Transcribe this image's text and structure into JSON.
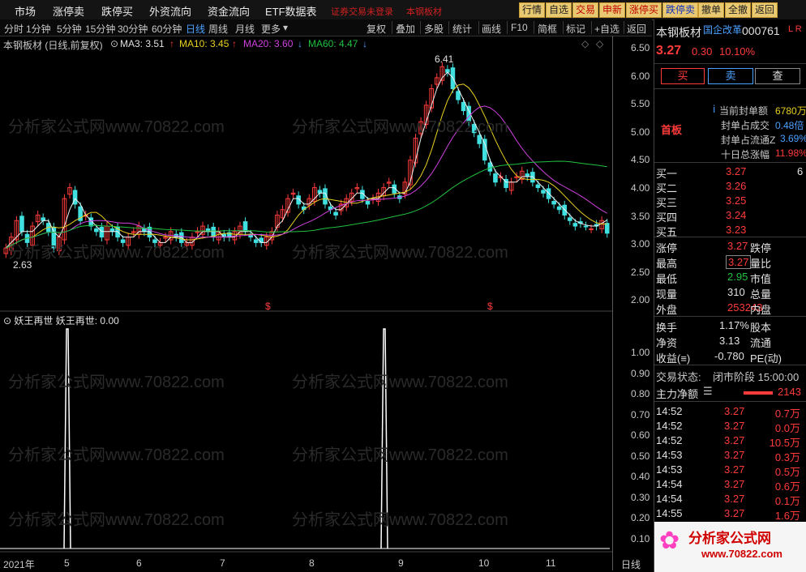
{
  "topbar": {
    "menus": [
      "市场",
      "涨停卖",
      "跌停买",
      "外资流向",
      "资金流向",
      "ETF数据表"
    ],
    "notice": "证券交易未登录",
    "notice2": "本钢板材",
    "buttons": [
      "行情",
      "自选",
      "交易",
      "申新",
      "涨停买",
      "跌停卖",
      "撤单",
      "全撤",
      "返回"
    ]
  },
  "period_toolbar": {
    "periods": [
      "分时",
      "1分钟",
      "5分钟",
      "15分钟",
      "30分钟",
      "60分钟",
      "日线",
      "周线",
      "月线",
      "更多"
    ],
    "active": "日线",
    "tools": [
      "复权",
      "叠加",
      "多股",
      "统计",
      "画线",
      "F10",
      "简框",
      "标记",
      "+自选",
      "返回"
    ]
  },
  "info": {
    "title": "本钢板材 (日线,前复权)",
    "ma3": "MA3: 3.51",
    "ma10": "MA10: 3.45",
    "ma20": "MA20: 3.60",
    "ma60": "MA60: 4.47"
  },
  "indicator": {
    "name": "妖王再世",
    "value": "妖王再世: 0.00"
  },
  "price_axis": [
    "6.50",
    "6.00",
    "5.50",
    "5.00",
    "4.50",
    "4.00",
    "3.50",
    "3.00",
    "2.50",
    "2.00"
  ],
  "indicator_axis": [
    "1.00",
    "0.90",
    "0.80",
    "0.70",
    "0.60",
    "0.50",
    "0.40",
    "0.30",
    "0.20",
    "0.10"
  ],
  "annotations": {
    "high": "6.41",
    "low": "2.63"
  },
  "signal_marks": [
    "$",
    "$"
  ],
  "x_dates": [
    "2021年",
    "5",
    "6",
    "7",
    "8",
    "9",
    "10",
    "11"
  ],
  "right_edge_label": "日线",
  "watermark": "分析家公式网www.70822.com",
  "logo": {
    "text": "分析家公式网",
    "url": "www.70822.com"
  },
  "stock": {
    "name": "本钢板材",
    "tag": "国企改革",
    "code": "000761",
    "flags": "L R",
    "price": "3.27",
    "change": "0.30",
    "pct": "10.10%",
    "buy_label": "买",
    "sell_label": "卖",
    "query_label": "查",
    "first_board": "首板",
    "seal": [
      {
        "label": "当前封单额",
        "value": "6780万"
      },
      {
        "label": "封单占成交",
        "value": "0.48倍"
      },
      {
        "label": "封单占流通Z",
        "value": "3.69%"
      },
      {
        "label": "十日总涨幅",
        "value": "11.98%"
      }
    ],
    "bids": [
      {
        "label": "买一",
        "price": "3.27",
        "vol": "6"
      },
      {
        "label": "买二",
        "price": "3.26",
        "vol": ""
      },
      {
        "label": "买三",
        "price": "3.25",
        "vol": ""
      },
      {
        "label": "买四",
        "price": "3.24",
        "vol": ""
      },
      {
        "label": "买五",
        "price": "3.23",
        "vol": ""
      }
    ],
    "stats": [
      {
        "l1": "涨停",
        "v1": "3.27",
        "l2": "跌停"
      },
      {
        "l1": "最高",
        "v1": "3.27",
        "l2": "量比"
      },
      {
        "l1": "最低",
        "v1": "2.95",
        "l2": "市值"
      },
      {
        "l1": "现量",
        "v1": "310",
        "l2": "总量"
      },
      {
        "l1": "外盘",
        "v1": "253243",
        "l2": "内盘"
      }
    ],
    "fund": [
      {
        "l1": "换手",
        "v1": "1.17%",
        "l2": "股本"
      },
      {
        "l1": "净资",
        "v1": "3.13",
        "l2": "流通"
      },
      {
        "l1": "收益(≡)",
        "v1": "-0.780",
        "l2": "PE(动)"
      }
    ],
    "trade_status_label": "交易状态:",
    "trade_status": "闭市阶段 15:00:00",
    "main_net_label": "主力净额",
    "main_net_value": "2143",
    "ticks": [
      {
        "t": "14:52",
        "p": "3.27",
        "v": "0.7万"
      },
      {
        "t": "14:52",
        "p": "3.27",
        "v": "0.0万"
      },
      {
        "t": "14:52",
        "p": "3.27",
        "v": "10.5万"
      },
      {
        "t": "14:53",
        "p": "3.27",
        "v": "0.3万"
      },
      {
        "t": "14:53",
        "p": "3.27",
        "v": "0.5万"
      },
      {
        "t": "14:54",
        "p": "3.27",
        "v": "0.6万"
      },
      {
        "t": "14:54",
        "p": "3.27",
        "v": "0.1万"
      },
      {
        "t": "14:55",
        "p": "3.27",
        "v": "1.6万"
      }
    ]
  },
  "chart_data": {
    "type": "candlestick",
    "period": "daily",
    "ylim": [
      2.0,
      6.6
    ],
    "months": [
      "5",
      "6",
      "7",
      "8",
      "9",
      "10",
      "11"
    ],
    "close": [
      3.0,
      3.2,
      3.5,
      3.3,
      3.1,
      3.4,
      3.6,
      3.5,
      3.3,
      3.0,
      3.2,
      3.9,
      4.1,
      3.8,
      3.5,
      3.6,
      3.4,
      3.3,
      3.2,
      3.4,
      3.3,
      3.2,
      3.1,
      3.2,
      3.3,
      3.4,
      3.3,
      3.2,
      3.1,
      3.1,
      3.2,
      3.3,
      3.2,
      3.1,
      3.1,
      3.2,
      3.3,
      3.4,
      3.3,
      3.2,
      3.3,
      3.2,
      3.2,
      3.3,
      3.4,
      3.3,
      3.2,
      3.1,
      3.1,
      3.2,
      3.3,
      3.6,
      3.7,
      3.9,
      4.0,
      3.8,
      3.7,
      3.9,
      4.1,
      4.0,
      3.8,
      3.7,
      3.6,
      3.8,
      3.9,
      4.0,
      4.1,
      3.9,
      3.8,
      3.9,
      4.0,
      4.1,
      4.2,
      4.0,
      3.9,
      4.2,
      4.6,
      5.0,
      5.3,
      5.6,
      5.9,
      6.1,
      6.3,
      6.2,
      5.9,
      5.7,
      5.5,
      5.3,
      5.1,
      4.9,
      4.6,
      4.4,
      4.2,
      4.3,
      4.1,
      4.2,
      4.3,
      4.4,
      4.3,
      4.2,
      4.1,
      4.0,
      3.9,
      3.8,
      3.7,
      3.6,
      3.5,
      3.4,
      3.45,
      3.4,
      3.35,
      3.4,
      3.5,
      3.27
    ],
    "ma3": [
      3.0,
      3.1,
      3.2,
      3.3,
      3.3,
      3.3,
      3.4,
      3.5,
      3.5,
      3.3,
      3.2,
      3.4,
      3.7,
      3.9,
      3.8,
      3.6,
      3.5,
      3.4,
      3.3,
      3.3,
      3.3,
      3.3,
      3.2,
      3.2,
      3.2,
      3.3,
      3.3,
      3.3,
      3.2,
      3.1,
      3.1,
      3.2,
      3.2,
      3.2,
      3.1,
      3.1,
      3.2,
      3.3,
      3.3,
      3.3,
      3.3,
      3.2,
      3.2,
      3.2,
      3.3,
      3.3,
      3.3,
      3.2,
      3.1,
      3.1,
      3.2,
      3.4,
      3.5,
      3.7,
      3.9,
      3.9,
      3.8,
      3.8,
      3.9,
      4.0,
      4.0,
      3.8,
      3.7,
      3.7,
      3.8,
      3.9,
      4.0,
      4.0,
      3.9,
      3.9,
      3.9,
      4.0,
      4.1,
      4.1,
      4.0,
      4.0,
      4.2,
      4.6,
      5.0,
      5.3,
      5.6,
      5.9,
      6.1,
      6.2,
      6.1,
      5.9,
      5.7,
      5.5,
      5.3,
      5.1,
      4.9,
      4.6,
      4.4,
      4.3,
      4.2,
      4.2,
      4.2,
      4.3,
      4.3,
      4.3,
      4.2,
      4.1,
      4.0,
      3.9,
      3.8,
      3.7,
      3.6,
      3.5,
      3.45,
      3.42,
      3.4,
      3.4,
      3.45,
      3.51
    ],
    "ma60_end": 4.47,
    "high_label": 6.41,
    "low_label": 2.63,
    "indicator_spikes_month": [
      "5",
      "9"
    ]
  }
}
